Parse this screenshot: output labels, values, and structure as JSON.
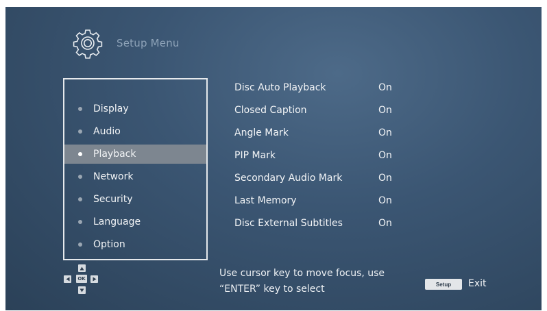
{
  "header": {
    "title": "Setup Menu",
    "icon": "gear-icon"
  },
  "menu": {
    "items": [
      {
        "label": "Display",
        "active": false
      },
      {
        "label": "Audio",
        "active": false
      },
      {
        "label": "Playback",
        "active": true
      },
      {
        "label": "Network",
        "active": false
      },
      {
        "label": "Security",
        "active": false
      },
      {
        "label": "Language",
        "active": false
      },
      {
        "label": "Option",
        "active": false
      }
    ]
  },
  "settings": {
    "rows": [
      {
        "name": "Disc Auto Playback",
        "value": "On"
      },
      {
        "name": "Closed Caption",
        "value": "On"
      },
      {
        "name": "Angle Mark",
        "value": "On"
      },
      {
        "name": "PIP Mark",
        "value": "On"
      },
      {
        "name": "Secondary Audio Mark",
        "value": "On"
      },
      {
        "name": "Last Memory",
        "value": "On"
      },
      {
        "name": "Disc External Subtitles",
        "value": "On"
      }
    ]
  },
  "footer": {
    "dpad": {
      "ok_label": "OK",
      "icon": "dpad-icon"
    },
    "help_line1": "Use cursor key to move focus, use",
    "help_line2": "“ENTER” key to select",
    "setup_key_label": "Setup",
    "exit_label": "Exit"
  },
  "colors": {
    "background": "#3b5673",
    "highlight": "#7d8690",
    "text": "#f2f4f6",
    "header_text": "#8ea3b8"
  }
}
